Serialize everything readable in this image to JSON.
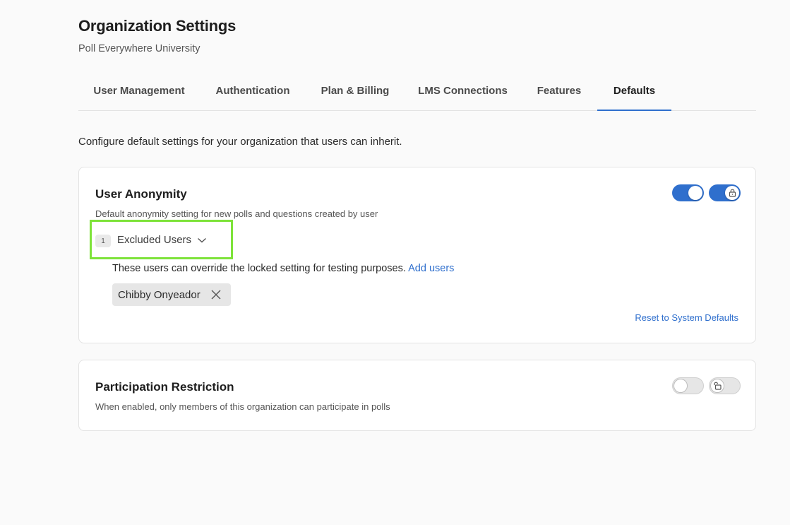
{
  "header": {
    "title": "Organization Settings",
    "subtitle": "Poll Everywhere University"
  },
  "tabs": [
    {
      "label": "User Management",
      "active": false
    },
    {
      "label": "Authentication",
      "active": false
    },
    {
      "label": "Plan & Billing",
      "active": false
    },
    {
      "label": "LMS Connections",
      "active": false
    },
    {
      "label": "Features",
      "active": false
    },
    {
      "label": "Defaults",
      "active": true
    }
  ],
  "intro": "Configure default settings for your organization that users can inherit.",
  "anonymity": {
    "title": "User Anonymity",
    "description": "Default anonymity setting for new polls and questions created by user",
    "enabled": true,
    "locked": true,
    "excluded_count": "1",
    "excluded_label": "Excluded Users",
    "override_text": "These users can override the locked setting for testing purposes.",
    "add_users_label": "Add users",
    "excluded_users": [
      "Chibby Onyeador"
    ],
    "reset_label": "Reset to System Defaults"
  },
  "restriction": {
    "title": "Participation Restriction",
    "description": "When enabled, only members of this organization can participate in polls",
    "enabled": false,
    "locked": false
  },
  "colors": {
    "accent": "#2f6fcd",
    "highlight": "#7ee33a"
  }
}
